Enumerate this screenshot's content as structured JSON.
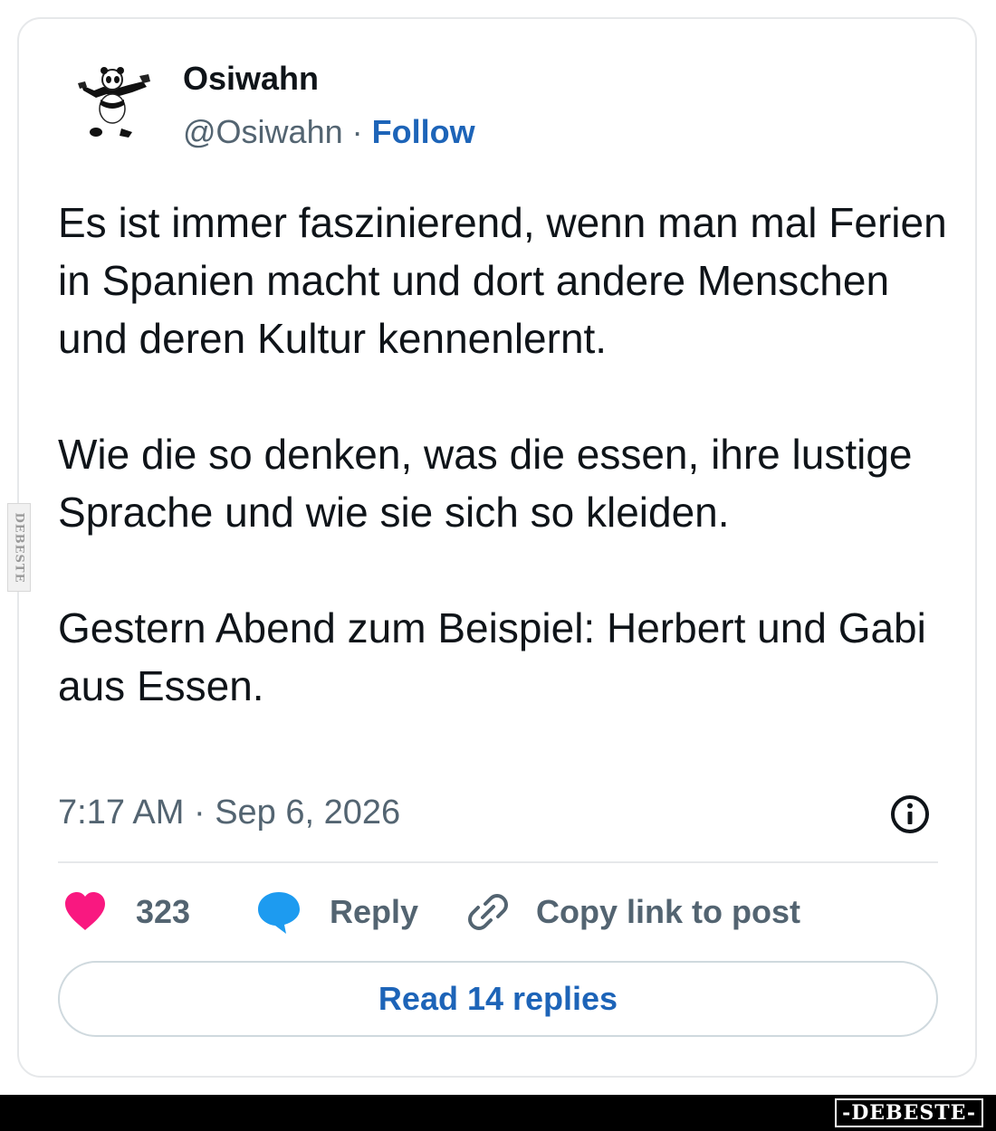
{
  "author": {
    "display_name": "Osiwahn",
    "handle": "@Osiwahn",
    "separator": "·",
    "follow_label": "Follow"
  },
  "tweet": {
    "paragraphs": [
      "Es ist immer faszinierend, wenn man mal Ferien in Spanien macht und dort andere Menschen und deren Kultur kennenlernt.",
      "Wie die so denken, was die essen, ihre lustige Sprache und wie sie sich so kleiden.",
      "Gestern Abend zum Beispiel: Herbert und Gabi aus Essen."
    ],
    "timestamp": "7:17 AM · Sep 6, 2026"
  },
  "actions": {
    "like_count": "323",
    "reply_label": "Reply",
    "copy_link_label": "Copy link to post"
  },
  "read_replies_label": "Read 14 replies",
  "watermark": {
    "side_text": "DEBESTE",
    "brand_text": "-DEBESTE-"
  },
  "colors": {
    "link_blue": "#1d64b8",
    "like_pink": "#f91880",
    "reply_blue": "#1d9bf0",
    "secondary_text": "#536471"
  },
  "icons": [
    "panda-avatar",
    "info-icon",
    "heart-icon",
    "speech-bubble-icon",
    "link-icon"
  ]
}
